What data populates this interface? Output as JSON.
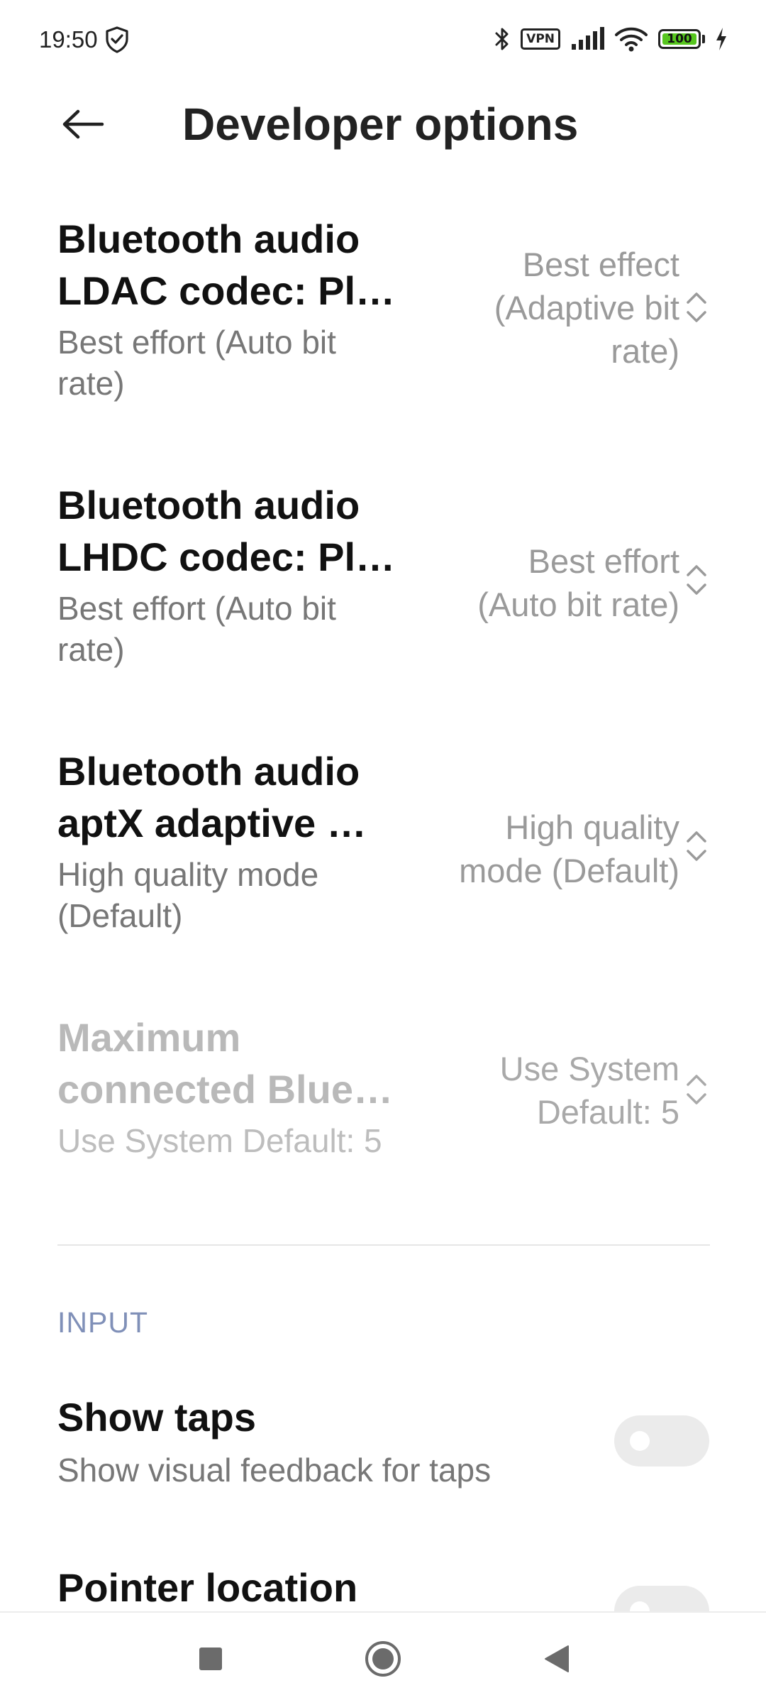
{
  "status_bar": {
    "time": "19:50",
    "vpn_label": "VPN",
    "battery_level": "100",
    "icons": [
      "shield-icon",
      "bluetooth-icon",
      "vpn-icon",
      "signal-icon",
      "wifi-icon",
      "battery-icon",
      "charging-icon"
    ],
    "battery_color": "#57c61f"
  },
  "header": {
    "title": "Developer options",
    "back_icon": "arrow-left-icon"
  },
  "settings": [
    {
      "title": "Bluetooth audio\nLDAC codec: Pl…",
      "summary": "Best effort (Auto bit\nrate)",
      "value": "Best effect\n(Adaptive bit\nrate)",
      "enabled": true
    },
    {
      "title": "Bluetooth audio\nLHDC codec: Pl…",
      "summary": "Best effort (Auto bit\nrate)",
      "value": "Best effort\n(Auto bit rate)",
      "enabled": true
    },
    {
      "title": "Bluetooth audio\naptX adaptive …",
      "summary": "High quality mode\n(Default)",
      "value": "High quality\nmode (Default)",
      "enabled": true
    },
    {
      "title": "Maximum\nconnected Blue…",
      "summary": "Use System Default: 5",
      "value": "Use System\nDefault: 5",
      "enabled": false
    }
  ],
  "input_section": {
    "header": "INPUT",
    "items": [
      {
        "title": "Show taps",
        "summary": "Show visual feedback for taps",
        "toggle_on": false
      },
      {
        "title": "Pointer location",
        "summary": "",
        "toggle_on": false
      }
    ]
  },
  "nav_bar": {
    "icons": [
      "recents-square-icon",
      "home-circle-icon",
      "back-triangle-icon"
    ]
  },
  "colors": {
    "section_header": "#8090b8",
    "summary_text": "#777777",
    "value_text": "#9a9a9a",
    "toggle_off": "#ebebeb"
  }
}
